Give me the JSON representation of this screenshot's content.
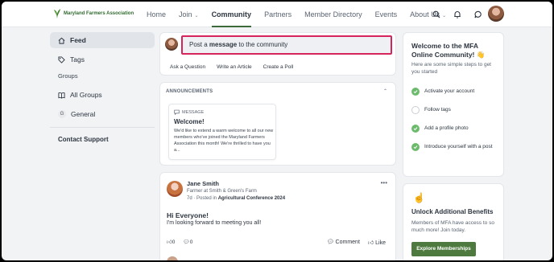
{
  "brand": {
    "name": "Maryland Farmers Association",
    "color": "#3d6a3a"
  },
  "nav": {
    "items": [
      {
        "label": "Home",
        "active": false,
        "dropdown": false
      },
      {
        "label": "Join",
        "active": false,
        "dropdown": true
      },
      {
        "label": "Community",
        "active": true,
        "dropdown": false
      },
      {
        "label": "Partners",
        "active": false,
        "dropdown": false
      },
      {
        "label": "Member Directory",
        "active": false,
        "dropdown": false
      },
      {
        "label": "Events",
        "active": false,
        "dropdown": false
      },
      {
        "label": "About Us",
        "active": false,
        "dropdown": true
      }
    ],
    "icons": [
      "search-icon",
      "bell-icon",
      "chat-icon",
      "avatar"
    ]
  },
  "sidebar": {
    "feed": "Feed",
    "tags": "Tags",
    "groups_heading": "Groups",
    "all_groups": "All Groups",
    "general_badge": "G",
    "general": "General",
    "contact_support": "Contact Support"
  },
  "composer": {
    "placeholder_pre": "Post a ",
    "placeholder_bold": "message",
    "placeholder_post": " to the community",
    "actions": [
      "Ask a Question",
      "Write an Article",
      "Create a Poll"
    ]
  },
  "announcements": {
    "heading": "ANNOUNCEMENTS",
    "card": {
      "type": "MESSAGE",
      "title": "Welcome!",
      "body": "We'd like to extend a warm welcome to all our new members who've joined the Maryland Farmers Association this month! We're thrilled to have you a..."
    }
  },
  "post": {
    "author": "Jane Smith",
    "role": "Farmer at Smith & Green's Farm",
    "meta_prefix": "7d · Posted in ",
    "meta_group": "Agricultural Conference 2024",
    "title": "Hi Everyone!",
    "text": "I'm looking forward to meeting you all!",
    "likes": "0",
    "comments": "0",
    "comment_label": "Comment",
    "like_label": "Like"
  },
  "welcome": {
    "title": "Welcome to the MFA Online Community! 👋",
    "subtitle": "Here are some simple steps to get you started",
    "steps": [
      {
        "label": "Activate your account",
        "done": true
      },
      {
        "label": "Follow tags",
        "done": false
      },
      {
        "label": "Add a profile photo",
        "done": true
      },
      {
        "label": "Introduce yourself with a post",
        "done": true
      }
    ]
  },
  "unlock": {
    "title": "Unlock Additional Benefits",
    "text": "Members of MFA have access to so much more! Join today.",
    "button": "Explore Memberships",
    "button_color": "#4e7a3f"
  }
}
